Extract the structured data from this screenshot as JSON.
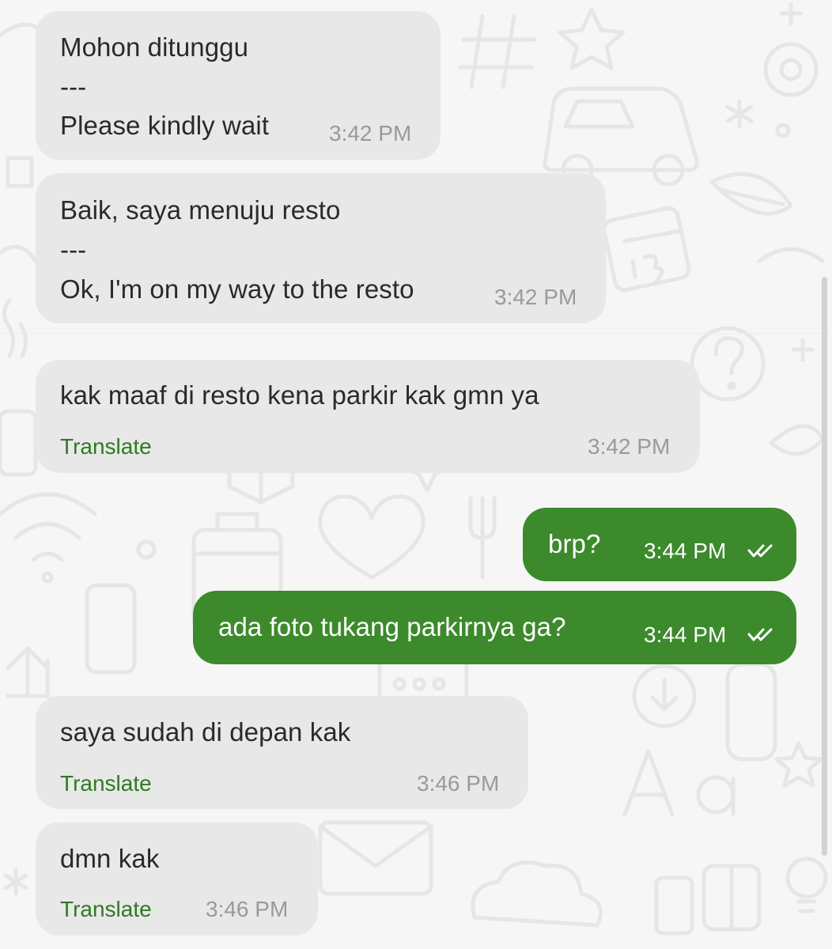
{
  "colors": {
    "incoming_bubble": "#e8e8e8",
    "outgoing_bubble": "#3c8a2c",
    "translate_link": "#2f7a23",
    "timestamp_incoming": "#9a9a9a",
    "background": "#f6f6f6"
  },
  "messages": [
    {
      "direction": "incoming",
      "lines": [
        "Mohon ditunggu",
        "---",
        "Please kindly wait"
      ],
      "time": "3:42 PM"
    },
    {
      "direction": "incoming",
      "lines": [
        "Baik, saya menuju resto",
        "---",
        "Ok, I'm on my way to the resto"
      ],
      "time": "3:42 PM"
    },
    {
      "direction": "incoming",
      "text": "kak maaf di resto kena parkir kak gmn ya",
      "translate_label": "Translate",
      "time": "3:42 PM"
    },
    {
      "direction": "outgoing",
      "text": "brp?",
      "time": "3:44 PM",
      "status_icon": "double-check-icon"
    },
    {
      "direction": "outgoing",
      "text": "ada foto tukang parkirnya ga?",
      "time": "3:44 PM",
      "status_icon": "double-check-icon"
    },
    {
      "direction": "incoming",
      "text": "saya sudah di depan kak",
      "translate_label": "Translate",
      "time": "3:46 PM"
    },
    {
      "direction": "incoming",
      "text": "dmn kak",
      "translate_label": "Translate",
      "time": "3:46 PM"
    }
  ]
}
